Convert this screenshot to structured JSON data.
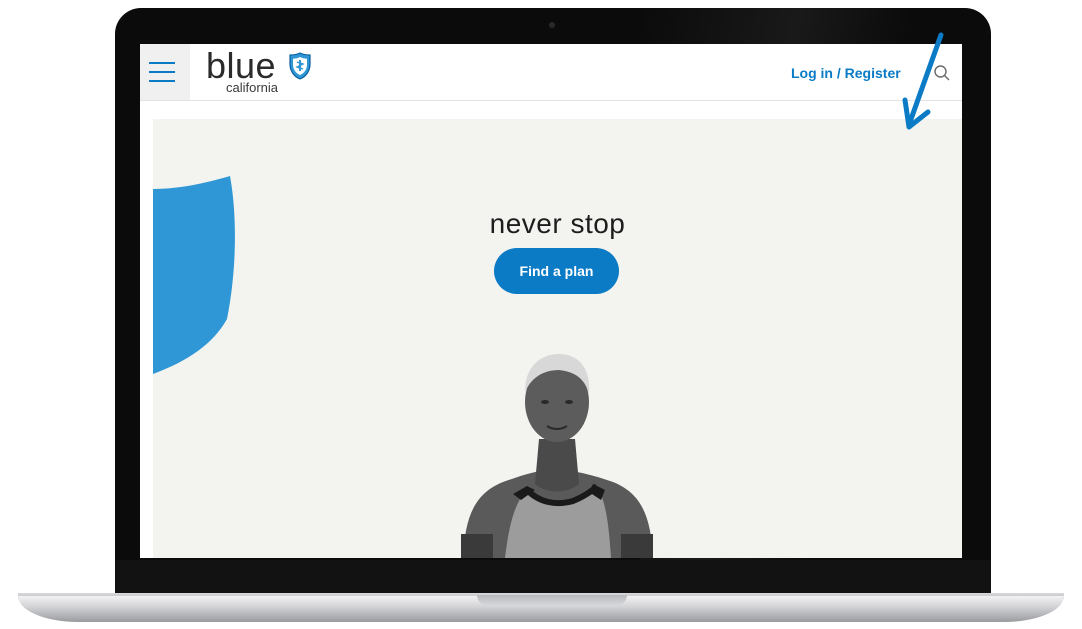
{
  "header": {
    "logo_word": "blue",
    "logo_sub": "california",
    "login_label": "Log in / Register"
  },
  "hero": {
    "tagline": "never stop",
    "cta_label": "Find a plan"
  },
  "colors": {
    "brand_blue": "#0b7bc6",
    "shield_blue": "#2f97d6",
    "hero_bg": "#f3f3ef",
    "annotation_arrow": "#0b7bc6"
  },
  "icons": [
    "hamburger-menu-icon",
    "blue-shield-logo-icon",
    "search-icon",
    "annotation-arrow-icon"
  ]
}
